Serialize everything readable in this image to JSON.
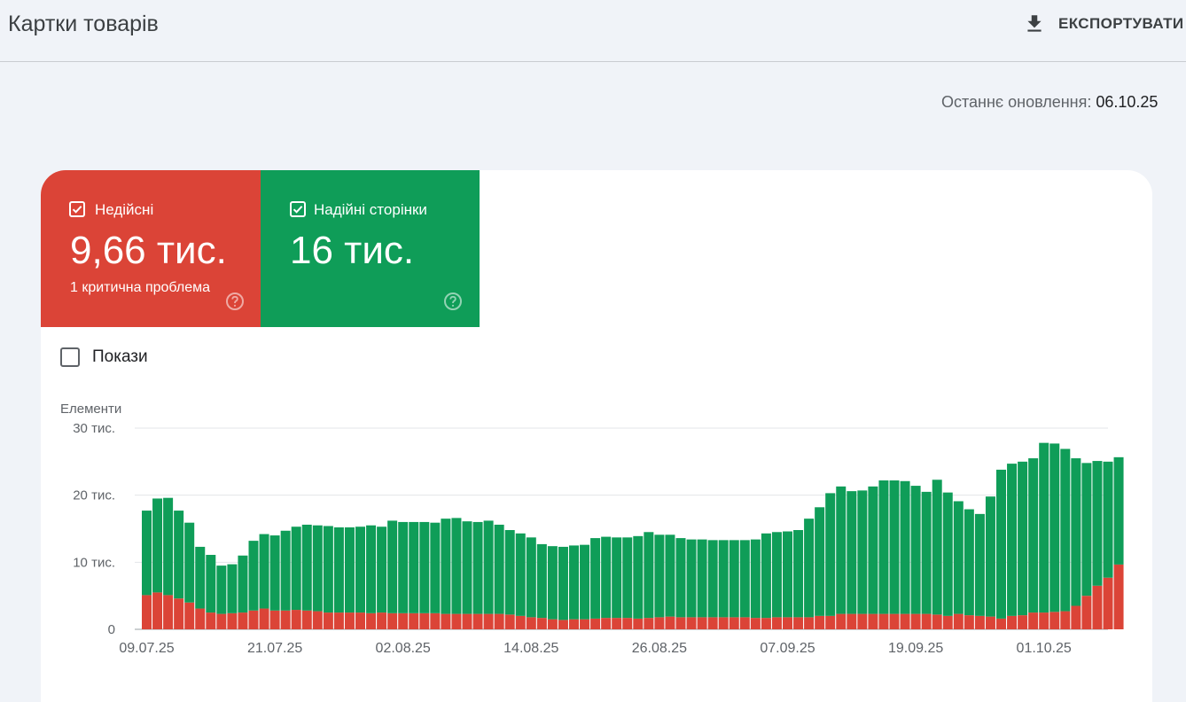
{
  "header": {
    "title": "Картки товарів",
    "export_label": "ЕКСПОРТУВАТИ"
  },
  "last_update": {
    "label": "Останнє оновлення: ",
    "date": "06.10.25"
  },
  "tiles": {
    "invalid": {
      "label": "Недійсні",
      "value": "9,66 тис.",
      "sub": "1 критична проблема",
      "color": "#db4437",
      "checked": true
    },
    "valid": {
      "label": "Надійні сторінки",
      "value": "16 тис.",
      "color": "#0f9d58",
      "checked": true
    }
  },
  "impressions": {
    "label": "Покази",
    "checked": false
  },
  "icons": {
    "export": "download-icon",
    "checkbox": "checkbox-checked-icon",
    "help": "help-circle-icon"
  },
  "chart_data": {
    "type": "bar",
    "stacked": true,
    "ylabel": "Елементи",
    "ylim": [
      0,
      30000
    ],
    "y_ticks": [
      {
        "value": 0,
        "label": "0"
      },
      {
        "value": 10000,
        "label": "10 тис."
      },
      {
        "value": 20000,
        "label": "20 тис."
      },
      {
        "value": 30000,
        "label": "30 тис."
      }
    ],
    "x_ticks": [
      {
        "index": 0,
        "label": "09.07.25"
      },
      {
        "index": 12,
        "label": "21.07.25"
      },
      {
        "index": 24,
        "label": "02.08.25"
      },
      {
        "index": 36,
        "label": "14.08.25"
      },
      {
        "index": 48,
        "label": "26.08.25"
      },
      {
        "index": 60,
        "label": "07.09.25"
      },
      {
        "index": 72,
        "label": "19.09.25"
      },
      {
        "index": 84,
        "label": "01.10.25"
      }
    ],
    "grid": true,
    "series": [
      {
        "name": "Недійсні",
        "color": "#db4437",
        "values": [
          5100,
          5500,
          5100,
          4600,
          4000,
          3100,
          2500,
          2300,
          2400,
          2500,
          2800,
          3100,
          2800,
          2800,
          2900,
          2800,
          2700,
          2500,
          2500,
          2500,
          2500,
          2400,
          2500,
          2400,
          2400,
          2400,
          2400,
          2400,
          2300,
          2300,
          2300,
          2300,
          2300,
          2300,
          2200,
          2000,
          1800,
          1700,
          1500,
          1400,
          1500,
          1500,
          1600,
          1700,
          1700,
          1700,
          1600,
          1700,
          1800,
          1900,
          1800,
          1800,
          1800,
          1800,
          1800,
          1800,
          1800,
          1700,
          1700,
          1800,
          1800,
          1800,
          1800,
          2000,
          2000,
          2300,
          2300,
          2300,
          2300,
          2300,
          2300,
          2300,
          2300,
          2300,
          2200,
          2000,
          2300,
          2100,
          2000,
          1900,
          1600,
          2000,
          2100,
          2500,
          2500,
          2600,
          2700,
          3500,
          5000,
          6500,
          7700,
          9660
        ]
      },
      {
        "name": "Надійні сторінки",
        "color": "#0f9d58",
        "values": [
          12600,
          14000,
          14500,
          13100,
          11900,
          9200,
          8600,
          7200,
          7300,
          8500,
          10400,
          11100,
          11200,
          11900,
          12400,
          12800,
          12800,
          12900,
          12700,
          12700,
          12800,
          13100,
          12800,
          13800,
          13600,
          13600,
          13600,
          13500,
          14200,
          14300,
          13800,
          13700,
          13900,
          13300,
          12600,
          12300,
          11900,
          11000,
          10900,
          10900,
          11000,
          11100,
          12000,
          12100,
          12000,
          12000,
          12300,
          12800,
          12300,
          12200,
          11800,
          11600,
          11600,
          11500,
          11500,
          11500,
          11500,
          11700,
          12600,
          12700,
          12800,
          13000,
          14700,
          16200,
          18300,
          19000,
          18300,
          18400,
          19000,
          19900,
          19900,
          19800,
          19100,
          18200,
          20100,
          18400,
          16800,
          15800,
          15200,
          17900,
          22200,
          22700,
          22900,
          23000,
          25300,
          25100,
          24200,
          22000,
          19800,
          18600,
          17300,
          16000
        ]
      }
    ]
  }
}
